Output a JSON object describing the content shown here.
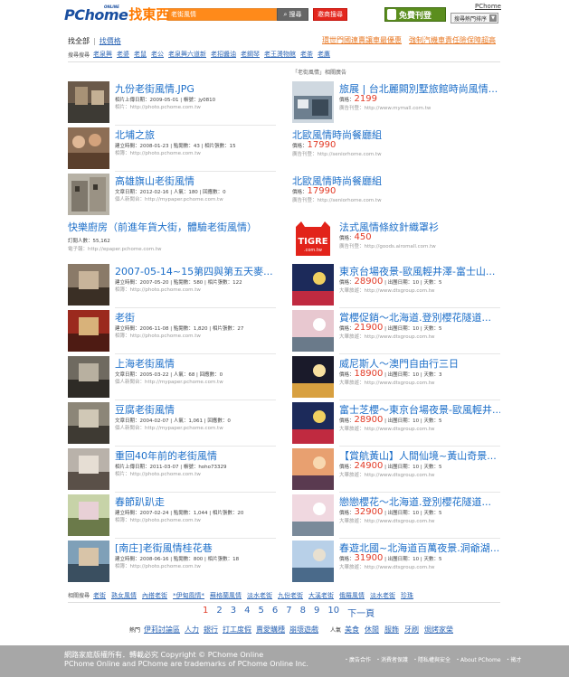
{
  "header": {
    "logo_main": "PChome",
    "logo_sub": "ONLINE",
    "logo_cn": "找東西",
    "search_value": "老街風情",
    "search_button": "搜尋",
    "shop_button": "邀商搜尋",
    "free_ad": "免費刊登",
    "pchome_link": "PChome",
    "rank_button": "搜尋熱門排序"
  },
  "tabs": {
    "all": "找全部",
    "price": "找價格",
    "promo1": "環世門國連賣讓車最優惠",
    "promo2": "強制汽機車責任險保障超高"
  },
  "hot": {
    "label": "搜尋搜尋",
    "items": [
      "老泉興",
      "老婆",
      "老鼠",
      "老公",
      "老泉興六道新",
      "老招醬油",
      "老鋼琴",
      "老王燙物館",
      "老茶",
      "老鷹"
    ]
  },
  "ad_label": "「老街風情」相關廣告",
  "left_results": [
    {
      "title": "九份老街風情.JPG",
      "meta": "相片上傳日期：2009-05-01 | 帳號：jy0810",
      "url": "相片：http://photo.pchome.com.tw"
    },
    {
      "title": "北埔之旅",
      "meta": "建立時間：2008-01-23 | 點閱數：43 | 相片張數：15",
      "url": "相簿：http://photo.pchome.com.tw"
    },
    {
      "title": "高雄旗山老街風情",
      "meta": "文章日期：2012-02-16 | 人氣：180 | 回應數：0",
      "url": "個人新聞台：http://mypaper.pchome.com.tw"
    }
  ],
  "wide_result": {
    "title": "快樂廚房（前進年貨大街，體驗老街風情）",
    "meta": "訂閱人數：55,162",
    "url": "電子報：http://epaper.pchome.com.tw"
  },
  "left_results2": [
    {
      "title": "2007-05-14~15第四與第五天麥...",
      "meta": "建立時間：2007-05-20 | 點閱數：580 | 相片張數：122",
      "url": "相簿：http://photo.pchome.com.tw"
    },
    {
      "title": "老街",
      "meta": "建立時間：2006-11-08 | 點閱數：1,820 | 相片張數：27",
      "url": "相簿：http://photo.pchome.com.tw"
    },
    {
      "title": "上海老街風情",
      "meta": "文章日期：2005-03-22 | 人氣：68 | 回應數：0",
      "url": "個人新聞台：http://mypaper.pchome.com.tw"
    },
    {
      "title": "豆腐老街風情",
      "meta": "文章日期：2004-02-07 | 人氣：1,061 | 回應數：0",
      "url": "個人新聞台：http://mypaper.pchome.com.tw"
    },
    {
      "title": "重回40年前的老街風情",
      "meta": "相片上傳日期：2011-03-07 | 帳號：hoho73329",
      "url": "相片：http://photo.pchome.com.tw"
    },
    {
      "title": "春節趴趴走",
      "meta": "建立時間：2007-02-24 | 點閱數：1,044 | 相片張數：20",
      "url": "相簿：http://photo.pchome.com.tw"
    },
    {
      "title": "[南庄]老街風情桂花巷",
      "meta": "建立時間：2008-06-16 | 點閱數：800 | 相片張數：18",
      "url": "相簿：http://photo.pchome.com.tw"
    }
  ],
  "right_ads": [
    {
      "title": "旅展 | 台北麗闕別墅旅館時尚風情...",
      "price_label": "價格：",
      "price": "2199",
      "sub": "廣告刊登：http://www.mymall.com.tw"
    },
    {
      "title": "北歐風情時尚餐廳組",
      "price_label": "價格：",
      "price": "17990",
      "sub": "廣告刊登：http://seniorhome.com.tw"
    },
    {
      "title": "北歐風情時尚餐廳組",
      "price_label": "價格：",
      "price": "17990",
      "sub": "廣告刊登：http://seniorhome.com.tw"
    },
    {
      "title": "法式風情條紋針織罩衫",
      "price_label": "價格：",
      "price": "450",
      "sub": "廣告刊登：http://goods.airomall.com.tw"
    }
  ],
  "right_travel": [
    {
      "title": "東京台場夜景-歐風輕井澤-富士山...",
      "price_label": "價格：",
      "price": "28900",
      "extra": " | 出團日期：10 | 天數：5",
      "sub": "大華旅遊：http://www.dtsgroup.com.tw"
    },
    {
      "title": "賞櫻促銷～北海道.登別櫻花隧道...",
      "price_label": "價格：",
      "price": "21900",
      "extra": " | 出團日期：10 | 天數：5",
      "sub": "大華旅遊：http://www.dtsgroup.com.tw"
    },
    {
      "title": "威尼斯人～澳門自由行三日",
      "price_label": "價格：",
      "price": "18900",
      "extra": " | 出團日期：10 | 天數：3",
      "sub": "大華旅遊：http://www.dtsgroup.com.tw"
    },
    {
      "title": "富士芝櫻～東京台場夜景-歐風輕井...",
      "price_label": "價格：",
      "price": "28900",
      "extra": " | 出團日期：10 | 天數：5",
      "sub": "大華旅遊：http://www.dtsgroup.com.tw"
    },
    {
      "title": "【賞航黃山】人間仙境~黃山奇景...",
      "price_label": "價格：",
      "price": "24900",
      "extra": " | 出團日期：10 | 天數：5",
      "sub": "大華旅遊：http://www.dtsgroup.com.tw"
    },
    {
      "title": "戀戀櫻花～北海道.登別櫻花隧道...",
      "price_label": "價格：",
      "price": "32900",
      "extra": " | 出團日期：10 | 天數：5",
      "sub": "大華旅遊：http://www.dtsgroup.com.tw"
    },
    {
      "title": "春遊北國~北海道百萬夜景.洞爺湖...",
      "price_label": "價格：",
      "price": "31900",
      "extra": " | 出團日期：10 | 天數：5",
      "sub": "大華旅遊：http://www.dtsgroup.com.tw"
    }
  ],
  "tigre_text": "TIGRE",
  "tigre_sub": ".com.tw",
  "related": {
    "label": "相關搜尋",
    "items": [
      "老街",
      "熟女風情",
      "內搭老街",
      "*伊甸風情*",
      "蘇格蘭風情",
      "淡水老街",
      "九份老街",
      "大溪老街",
      "俄羅風情",
      "淡水老街",
      "珍珠"
    ]
  },
  "pager": {
    "pages": [
      "1",
      "2",
      "3",
      "4",
      "5",
      "6",
      "7",
      "8",
      "9",
      "10"
    ],
    "current": "1",
    "next": "下一頁"
  },
  "hot_footer": {
    "label": "熱門",
    "items": [
      "伊莉討論區",
      "人力",
      "銀行",
      "打工度假",
      "賣愛購穗",
      "崩壞遊戲"
    ]
  },
  "pop_footer": {
    "label": "人氣",
    "items": [
      "美食",
      "休閒",
      "服飾",
      "牙刷",
      "焗烤家榮"
    ]
  },
  "footer": {
    "copy1": "網路家庭版權所有．轉載必究 Copyright © PChome Online",
    "copy2": "PChome Online and PChome are trademarks of PChome Online Inc.",
    "links": [
      "・廣告合作",
      "・消費者保護",
      "・隱私權與安全",
      "・About PChome",
      "・徵才"
    ]
  },
  "colors": {
    "link": "#1d6fc9",
    "price": "#e23a26",
    "orange": "#ff8a1a",
    "footer": "#a7a7a7"
  }
}
